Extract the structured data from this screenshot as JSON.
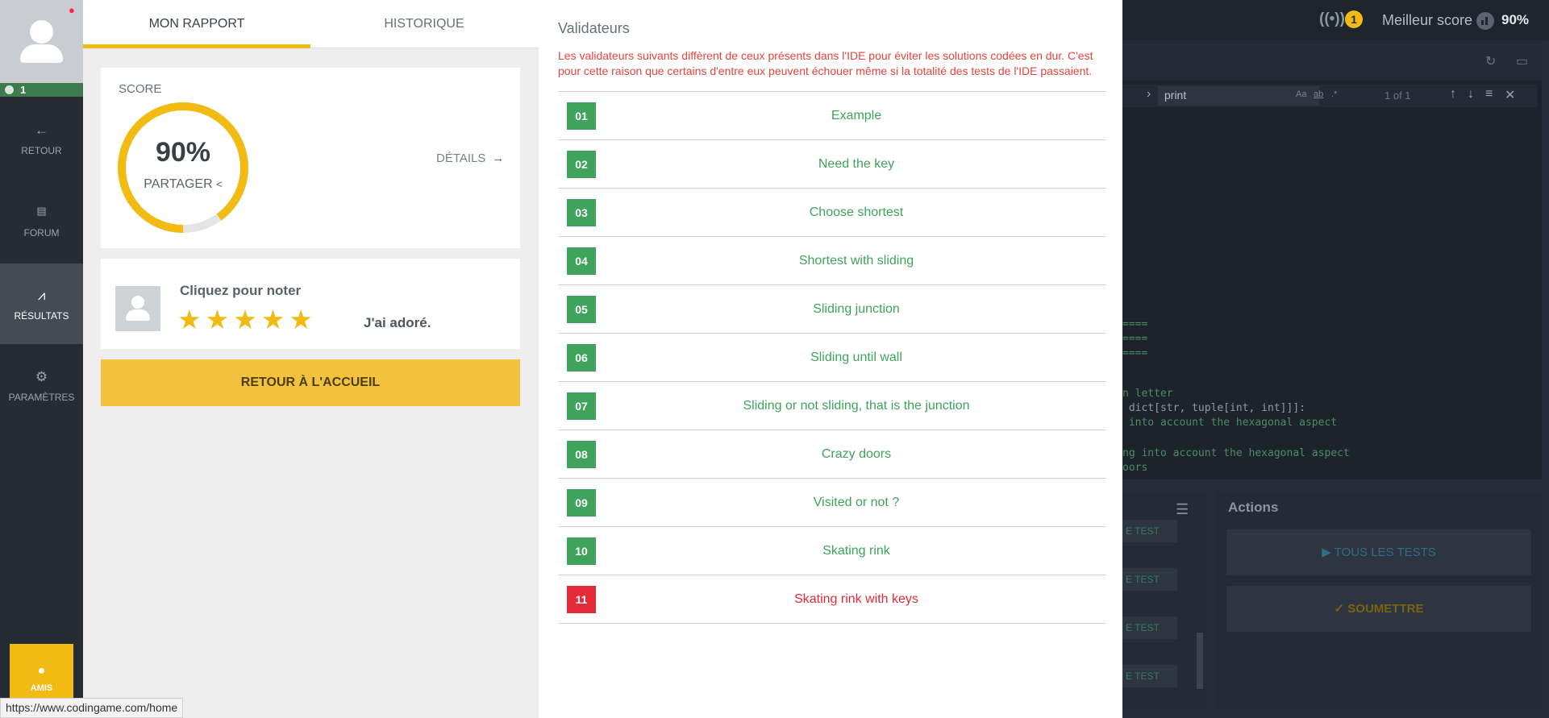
{
  "ide": {
    "live_count": "1",
    "best_score_label": "Meilleur score",
    "best_score_value": "90%",
    "find_value": "print",
    "find_opts": [
      "Aa",
      "ab",
      ".*"
    ],
    "find_count": "1 of 1",
    "code_lines": [
      "====",
      "====",
      "====",
      "n letter",
      " dict[str, tuple[int, int]]]:",
      " into account the hexagonal aspect",
      "ng into account the hexagonal aspect",
      "oors"
    ],
    "test_buttons": [
      "E TEST",
      "E TEST",
      "E TEST",
      "E TEST"
    ],
    "actions_title": "Actions",
    "run_all_label": "TOUS LES TESTS",
    "submit_label": "SOUMETTRE"
  },
  "nav": {
    "level": "1",
    "items": [
      {
        "label": "RETOUR",
        "icon": "arrow-left-icon"
      },
      {
        "label": "FORUM",
        "icon": "forum-icon"
      },
      {
        "label": "RÉSULTATS",
        "icon": "chart-icon"
      },
      {
        "label": "PARAMÈTRES",
        "icon": "gear-icon"
      }
    ],
    "friends_label": "AMIS"
  },
  "report": {
    "tabs": [
      "MON RAPPORT",
      "HISTORIQUE"
    ],
    "score_label": "SCORE",
    "score_value": "90%",
    "score_fraction": 0.9,
    "share_label": "PARTAGER",
    "details_label": "DÉTAILS",
    "rate_title": "Cliquez pour noter",
    "stars": 5,
    "rate_text": "J'ai adoré.",
    "home_button": "RETOUR À L'ACCUEIL"
  },
  "validators": {
    "title": "Validateurs",
    "warning": "Les validateurs suivants diffèrent de ceux présents dans l'IDE pour éviter les solutions codées en dur. C'est pour cette raison que certains d'entre eux peuvent échouer même si la totalité des tests de l'IDE passaient.",
    "items": [
      {
        "num": "01",
        "name": "Example",
        "passed": true
      },
      {
        "num": "02",
        "name": "Need the key",
        "passed": true
      },
      {
        "num": "03",
        "name": "Choose shortest",
        "passed": true
      },
      {
        "num": "04",
        "name": "Shortest with sliding",
        "passed": true
      },
      {
        "num": "05",
        "name": "Sliding junction",
        "passed": true
      },
      {
        "num": "06",
        "name": "Sliding until wall",
        "passed": true
      },
      {
        "num": "07",
        "name": "Sliding or not sliding, that is the junction",
        "passed": true
      },
      {
        "num": "08",
        "name": "Crazy doors",
        "passed": true
      },
      {
        "num": "09",
        "name": "Visited or not ?",
        "passed": true
      },
      {
        "num": "10",
        "name": "Skating rink",
        "passed": true
      },
      {
        "num": "11",
        "name": "Skating rink with keys",
        "passed": false
      }
    ]
  },
  "status_url": "https://www.codingame.com/home",
  "colors": {
    "accent": "#f2bb13",
    "pass": "#3fa35b",
    "fail": "#e32b37",
    "warning": "#e8443a"
  }
}
